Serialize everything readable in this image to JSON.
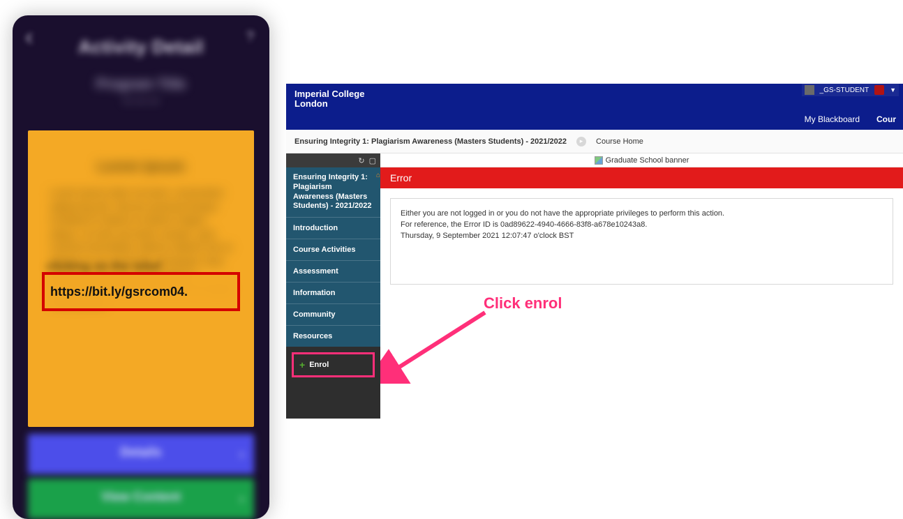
{
  "mobile": {
    "title": "Activity Detail",
    "link_ghost": "clicking on the relief",
    "link": "https://bit.ly/gsrcom04.",
    "blur_heading": "Lorem Ipsum",
    "blur_body": "Lorem ipsum dolor sit amet, consectetur adipiscing elit. Sed do eiusmod tempor incididunt ut labore et dolore magna aliqua. Ut enim ad minim veniam, quis nostrud exercitation ullamco laboris nisi ut aliquip ex ea commodo consequat. Duis aute irure dolor in reprehenderit in voluptate velit esse cillum dolore eu fugiat nulla pariatur.",
    "blue_btn": "Details",
    "green_btn": "View Content"
  },
  "bb": {
    "brand_line1": "Imperial College",
    "brand_line2": "London",
    "user": "_GS-STUDENT",
    "nav": {
      "myblackboard": "My Blackboard",
      "courses": "Cour"
    },
    "breadcrumb_course": "Ensuring Integrity 1: Plagiarism Awareness (Masters Students) - 2021/2022",
    "breadcrumb_page": "Course Home",
    "banner_alt": "Graduate School banner",
    "error_title": "Error",
    "error_lines": {
      "l1": "Either you are not logged in or you do not have the appropriate privileges to perform this action.",
      "l2": "For reference, the Error ID is 0ad89622-4940-4666-83f8-a678e10243a8.",
      "l3": "Thursday, 9 September 2021 12:07:47 o'clock BST"
    },
    "sidebar": {
      "title": "Ensuring Integrity 1: Plagiarism Awareness (Masters Students) - 2021/2022",
      "items": [
        "Introduction",
        "Course Activities",
        "Assessment",
        "Information",
        "Community",
        "Resources"
      ],
      "enrol": "Enrol"
    }
  },
  "annotation": {
    "label": "Click enrol"
  }
}
